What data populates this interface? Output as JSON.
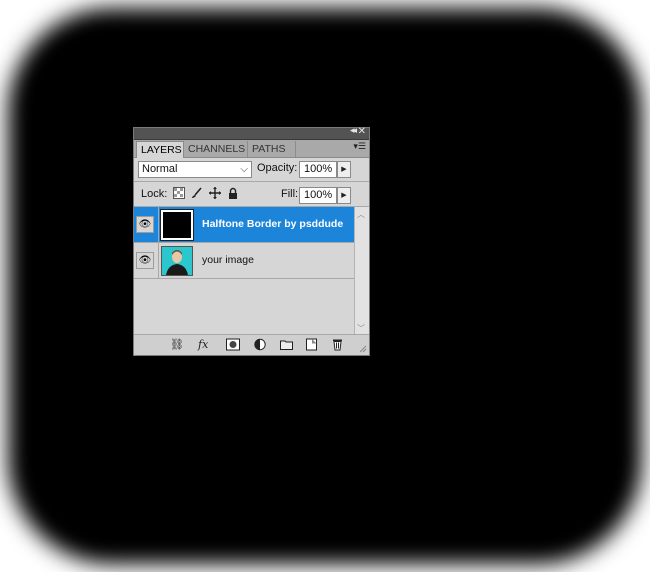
{
  "panel": {
    "tabs": [
      {
        "label": "LAYERS"
      },
      {
        "label": "CHANNELS"
      },
      {
        "label": "PATHS"
      }
    ],
    "blend_mode": "Normal",
    "opacity_label": "Opacity:",
    "opacity_value": "100%",
    "lock_label": "Lock:",
    "fill_label": "Fill:",
    "fill_value": "100%",
    "layers": [
      {
        "name": "Halftone Border by psddude",
        "selected": true,
        "visible": true
      },
      {
        "name": "your image",
        "selected": false,
        "visible": true
      }
    ]
  },
  "colors": {
    "selection": "#1c84d9",
    "panel_bg": "#d6d6d6",
    "vignette": "#000000"
  }
}
